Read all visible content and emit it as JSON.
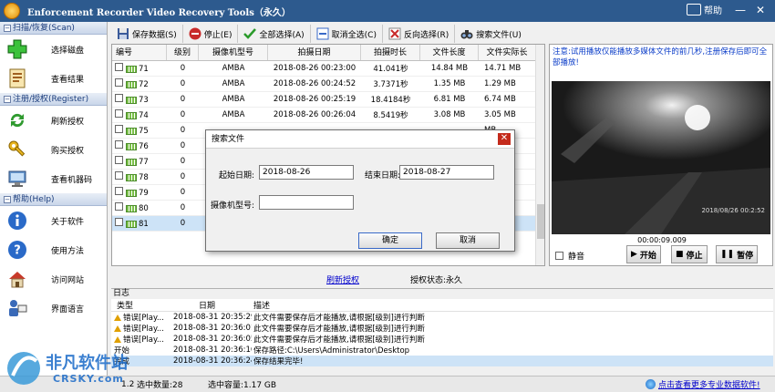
{
  "window": {
    "title": "Enforcement Recorder Video Recovery Tools（永久）",
    "help_label": "帮助"
  },
  "sidebar": {
    "sections": [
      {
        "label": "扫描/恢复(Scan)",
        "items": [
          {
            "label": "选择磁盘",
            "icon": "plus-icon"
          },
          {
            "label": "查看结果",
            "icon": "document-icon"
          }
        ]
      },
      {
        "label": "注册/授权(Register)",
        "items": [
          {
            "label": "刷新授权",
            "icon": "refresh-icon"
          },
          {
            "label": "购买授权",
            "icon": "key-icon"
          },
          {
            "label": "查看机器码",
            "icon": "computer-icon"
          }
        ]
      },
      {
        "label": "帮助(Help)",
        "items": [
          {
            "label": "关于软件",
            "icon": "info-icon"
          },
          {
            "label": "使用方法",
            "icon": "question-icon"
          },
          {
            "label": "访问网站",
            "icon": "home-icon"
          },
          {
            "label": "界面语言",
            "icon": "language-icon"
          }
        ]
      }
    ]
  },
  "toolbar": {
    "save": "保存数据(S)",
    "stop": "停止(E)",
    "select_all": "全部选择(A)",
    "deselect_all": "取消全选(C)",
    "invert": "反向选择(R)",
    "search": "搜索文件(U)"
  },
  "grid": {
    "columns": [
      "编号",
      "级别",
      "摄像机型号",
      "拍摄日期",
      "拍摄时长",
      "文件长度",
      "文件实际长"
    ],
    "rows": [
      {
        "id": "71",
        "level": "0",
        "camera": "AMBA",
        "date": "2018-08-26 00:23:00",
        "duration": "41.041秒",
        "size": "14.84 MB",
        "real": "14.71 MB"
      },
      {
        "id": "72",
        "level": "0",
        "camera": "AMBA",
        "date": "2018-08-26 00:24:52",
        "duration": "3.7371秒",
        "size": "1.35 MB",
        "real": "1.29 MB"
      },
      {
        "id": "73",
        "level": "0",
        "camera": "AMBA",
        "date": "2018-08-26 00:25:19",
        "duration": "18.4184秒",
        "size": "6.81 MB",
        "real": "6.74 MB"
      },
      {
        "id": "74",
        "level": "0",
        "camera": "AMBA",
        "date": "2018-08-26 00:26:04",
        "duration": "8.5419秒",
        "size": "3.08 MB",
        "real": "3.05 MB"
      },
      {
        "id": "75",
        "level": "0",
        "camera": "",
        "date": "",
        "duration": "",
        "size": "",
        "real": "MB"
      },
      {
        "id": "76",
        "level": "0",
        "camera": "",
        "date": "",
        "duration": "",
        "size": "",
        "real": "MB"
      },
      {
        "id": "77",
        "level": "0",
        "camera": "",
        "date": "",
        "duration": "",
        "size": "",
        "real": "MB"
      },
      {
        "id": "78",
        "level": "0",
        "camera": "",
        "date": "",
        "duration": "",
        "size": "",
        "real": "4 MB"
      },
      {
        "id": "79",
        "level": "0",
        "camera": "",
        "date": "",
        "duration": "",
        "size": "",
        "real": "4 MB"
      },
      {
        "id": "80",
        "level": "0",
        "camera": "",
        "date": "",
        "duration": "",
        "size": "",
        "real": "MB"
      },
      {
        "id": "81",
        "level": "0",
        "camera": "",
        "date": "",
        "duration": "",
        "size": "",
        "real": "5 MB"
      }
    ]
  },
  "status": {
    "refresh_link": "刷新授权",
    "license_status": "授权状态:永久"
  },
  "preview": {
    "note": "注意:试用播放仅能播放多媒体文件的前几秒,注册保存后即可全部播放!",
    "time": "00:00:09.009",
    "mute": "静音",
    "play": "开始",
    "stop": "停止",
    "pause": "暂停",
    "video_text": "2018/08/26 00:2:52"
  },
  "log": {
    "label": "日志",
    "columns": [
      "类型",
      "日期",
      "描述"
    ],
    "rows": [
      {
        "type": "错误[Play...",
        "date": "2018-08-31 20:35:29",
        "desc": "此文件需要保存后才能播放,请根据[级别]进行判断!"
      },
      {
        "type": "错误[Play...",
        "date": "2018-08-31 20:36:01",
        "desc": "此文件需要保存后才能播放,请根据[级别]进行判断!"
      },
      {
        "type": "错误[Play...",
        "date": "2018-08-31 20:36:05",
        "desc": "此文件需要保存后才能播放,请根据[级别]进行判断!"
      },
      {
        "type": "开始",
        "date": "2018-08-31 20:36:16",
        "desc": "保存路径:C:\\Users\\Administrator\\Desktop"
      },
      {
        "type": "完成",
        "date": "2018-08-31 20:36:24",
        "desc": "保存结果完毕!"
      }
    ]
  },
  "bottom": {
    "version": "1.2",
    "selected_count": "选中数量:28",
    "selected_size": "选中容量:1.17 GB",
    "more_link": "点击查看更多专业数据软件!"
  },
  "dialog": {
    "title": "搜索文件",
    "start_label": "起始日期:",
    "start_value": "2018-08-26",
    "end_label": "结束日期:",
    "end_value": "2018-08-27",
    "camera_label": "摄像机型号:",
    "camera_value": "",
    "ok": "确定",
    "cancel": "取消"
  },
  "watermark": {
    "line1": "非凡软件站",
    "line2": "CRSKY.com"
  }
}
